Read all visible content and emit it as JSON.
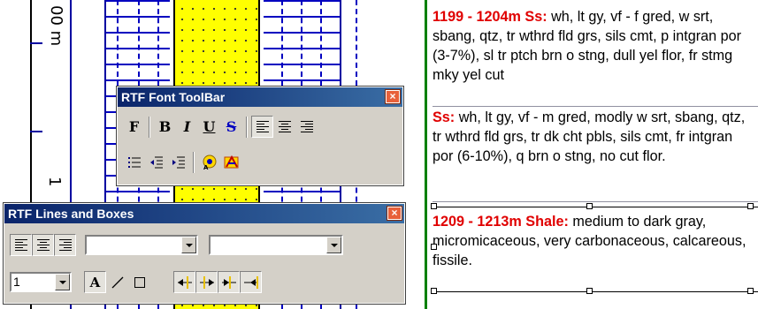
{
  "log": {
    "depth_label_top": "00 m",
    "depth_label_bottom": "1"
  },
  "font_toolbar": {
    "title": "RTF Font ToolBar",
    "close": "×",
    "row1": {
      "font": "F",
      "bold": "B",
      "italic": "I",
      "underline": "U",
      "strike": "S"
    }
  },
  "lines_toolbar": {
    "title": "RTF Lines and Boxes",
    "close": "×",
    "combo1": "",
    "combo2": "",
    "line_width": "1",
    "text_tool": "A"
  },
  "descriptions": [
    {
      "heading": "1199 - 1204m Ss:",
      "body": " wh, lt gy, vf - f gred, w srt, sbang, qtz, tr wthrd fld grs, sils cmt, p intgran por (3-7%), sl tr ptch brn o stng, dull yel flor, fr stmg mky yel cut"
    },
    {
      "heading": "Ss:",
      "body": " wh, lt gy, vf - m gred, modly w srt, sbang, qtz, tr wthrd fld grs, tr dk cht pbls, sils cmt, fr intgran por (6-10%), q brn o stng, no cut flor."
    },
    {
      "heading": "1209 - 1213m Shale:",
      "body": " medium to dark gray, micromicaceous, very carbonaceous, calcareous, fissile."
    }
  ],
  "colors": {
    "heading": "#e00000",
    "sand_fill": "#ffff00",
    "titlebar": "#0a246a",
    "divider": "#008000"
  }
}
